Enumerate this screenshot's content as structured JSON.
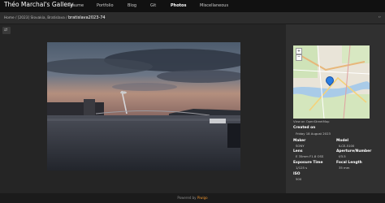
{
  "nav": {
    "brand": "Théo Marchal's Gallery",
    "items": [
      "Resume",
      "Portfolio",
      "Blog",
      "Git",
      "Photos",
      "Miscellaneous"
    ],
    "active": "Photos"
  },
  "breadcrumb": {
    "path": "Home / [2023] Slovakia, Bratislava / ",
    "title": "bratislava2023-74",
    "next_label": "››"
  },
  "tool_icon": "swap-icon",
  "map": {
    "credit": "View on OpenStreetMap"
  },
  "metadata": {
    "created_on_label": "Created on",
    "created_on": "Friday 18 August 2023",
    "maker_label": "Maker",
    "maker": "SONY",
    "model_label": "Model",
    "model": "ILCE-5100",
    "lens_label": "Lens",
    "lens": "E 35mm F1.8 OSS",
    "aperture_label": "Aperture/Number",
    "aperture": "f/3.5",
    "exposure_label": "Exposure Time",
    "exposure": "1/125 s",
    "focal_label": "Focal Length",
    "focal": "35 mm",
    "iso_label": "ISO",
    "iso": "500"
  },
  "footer": {
    "prefix": "Powered by ",
    "link": "Piwigo"
  },
  "colors": {
    "accent": "#e58f2e",
    "marker": "#2a7de1"
  }
}
